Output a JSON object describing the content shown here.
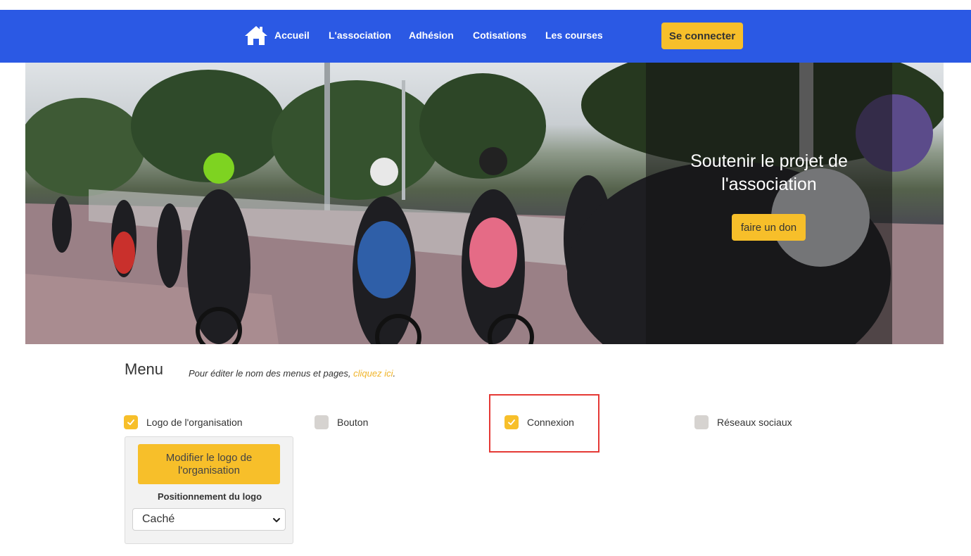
{
  "nav": {
    "items": [
      "Accueil",
      "L'association",
      "Adhésion",
      "Cotisations",
      "Les courses"
    ],
    "login_label": "Se connecter"
  },
  "hero": {
    "title_line1": "Soutenir le projet de",
    "title_line2": "l'association",
    "donate_label": "faire un don"
  },
  "menu": {
    "heading": "Menu",
    "hint_prefix": "Pour éditer le nom des menus et pages, ",
    "hint_link": "cliquez ici",
    "hint_suffix": ".",
    "options": [
      {
        "label": "Logo de l'organisation",
        "checked": true
      },
      {
        "label": "Bouton",
        "checked": false
      },
      {
        "label": "Connexion",
        "checked": true
      },
      {
        "label": "Réseaux sociaux",
        "checked": false
      }
    ],
    "logo_panel": {
      "edit_label": "Modifier le logo de l'organisation",
      "position_label": "Positionnement du logo",
      "position_value": "Caché"
    }
  },
  "colors": {
    "nav_bg": "#2b59e4",
    "accent": "#f7bf2a",
    "highlight": "#e53935"
  }
}
